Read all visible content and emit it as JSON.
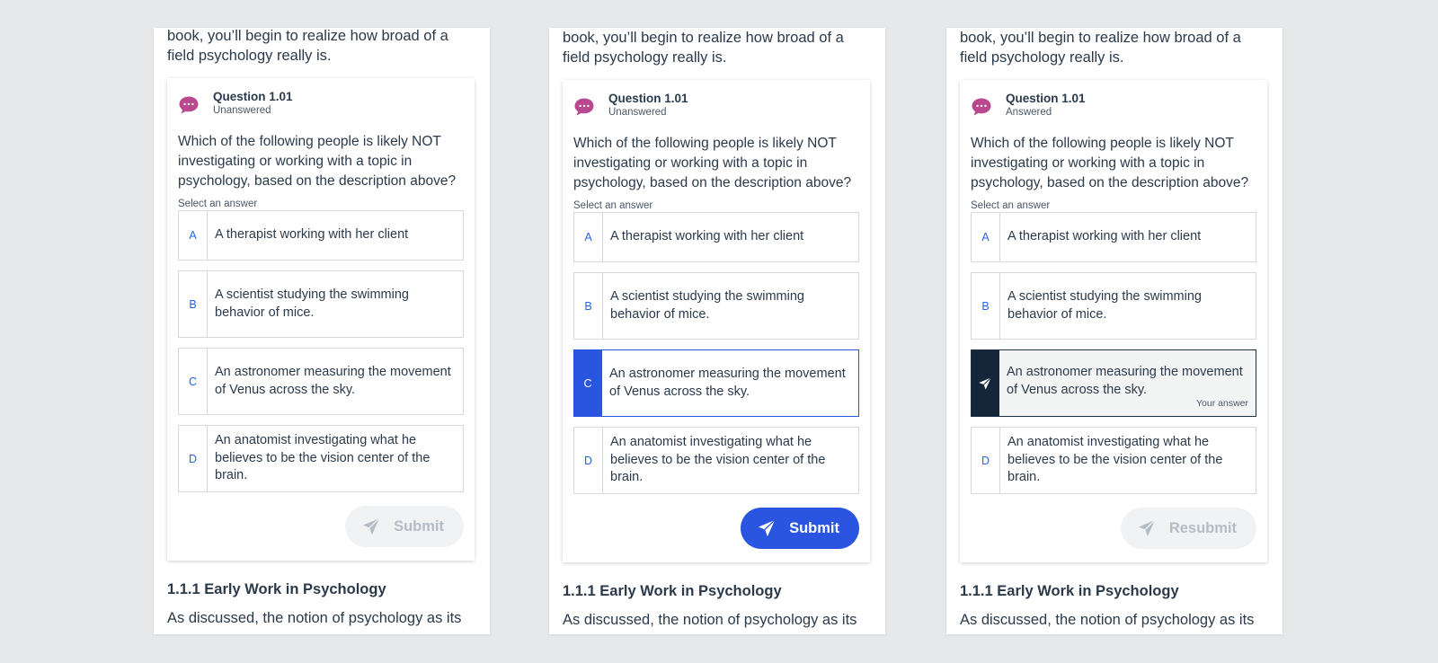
{
  "panels": [
    {
      "intro": "book, you’ll begin to realize how broad of a field psychology really is.",
      "question": {
        "title": "Question 1.01",
        "status": "Unanswered",
        "text": "Which of the following people is likely NOT investigating or working with a topic in psychology, based on the description above?",
        "select_label": "Select an answer",
        "options": [
          {
            "letter": "A",
            "text": "A therapist working with her client"
          },
          {
            "letter": "B",
            "text": "A scientist studying the swimming behavior of mice."
          },
          {
            "letter": "C",
            "text": "An astronomer measuring the movement of Venus across the sky."
          },
          {
            "letter": "D",
            "text": "An anatomist investigating what he believes to be the vision center of the brain."
          }
        ],
        "button_label": "Submit",
        "state": "disabled"
      },
      "section_heading": "1.1.1 Early Work in Psychology",
      "section_text": "As discussed, the notion of psychology as its own"
    },
    {
      "intro": "book, you’ll begin to realize how broad of a field psychology really is.",
      "question": {
        "title": "Question 1.01",
        "status": "Unanswered",
        "text": "Which of the following people is likely NOT investigating or working with a topic in psychology, based on the description above?",
        "select_label": "Select an answer",
        "options": [
          {
            "letter": "A",
            "text": "A therapist working with her client"
          },
          {
            "letter": "B",
            "text": "A scientist studying the swimming behavior of mice."
          },
          {
            "letter": "C",
            "text": "An astronomer measuring the movement of Venus across the sky.",
            "selected": true
          },
          {
            "letter": "D",
            "text": "An anatomist investigating what he believes to be the vision center of the brain."
          }
        ],
        "button_label": "Submit",
        "state": "active"
      },
      "section_heading": "1.1.1 Early Work in Psychology",
      "section_text": "As discussed, the notion of psychology as its own"
    },
    {
      "intro": "book, you’ll begin to realize how broad of a field psychology really is.",
      "question": {
        "title": "Question 1.01",
        "status": "Answered",
        "text": "Which of the following people is likely NOT investigating or working with a topic in psychology, based on the description above?",
        "select_label": "Select an answer",
        "options": [
          {
            "letter": "A",
            "text": "A therapist working with her client"
          },
          {
            "letter": "B",
            "text": "A scientist studying the swimming behavior of mice."
          },
          {
            "letter": "",
            "text": "An astronomer measuring the movement of Venus across the sky.",
            "answered": true,
            "answer_note": "Your answer"
          },
          {
            "letter": "D",
            "text": "An anatomist investigating what he believes to be the vision center of the brain."
          }
        ],
        "button_label": "Resubmit",
        "state": "disabled"
      },
      "section_heading": "1.1.1 Early Work in Psychology",
      "section_text": "As discussed, the notion of psychology as its own"
    }
  ],
  "colors": {
    "accent": "#2a55e0",
    "chat_icon": "#b8498f",
    "answered_dark": "#13263a",
    "letter_blue": "#2563eb",
    "disabled_text": "#b4bcc6"
  },
  "icons": {
    "question": "chat-bubble-icon",
    "submit": "paper-plane-icon"
  }
}
